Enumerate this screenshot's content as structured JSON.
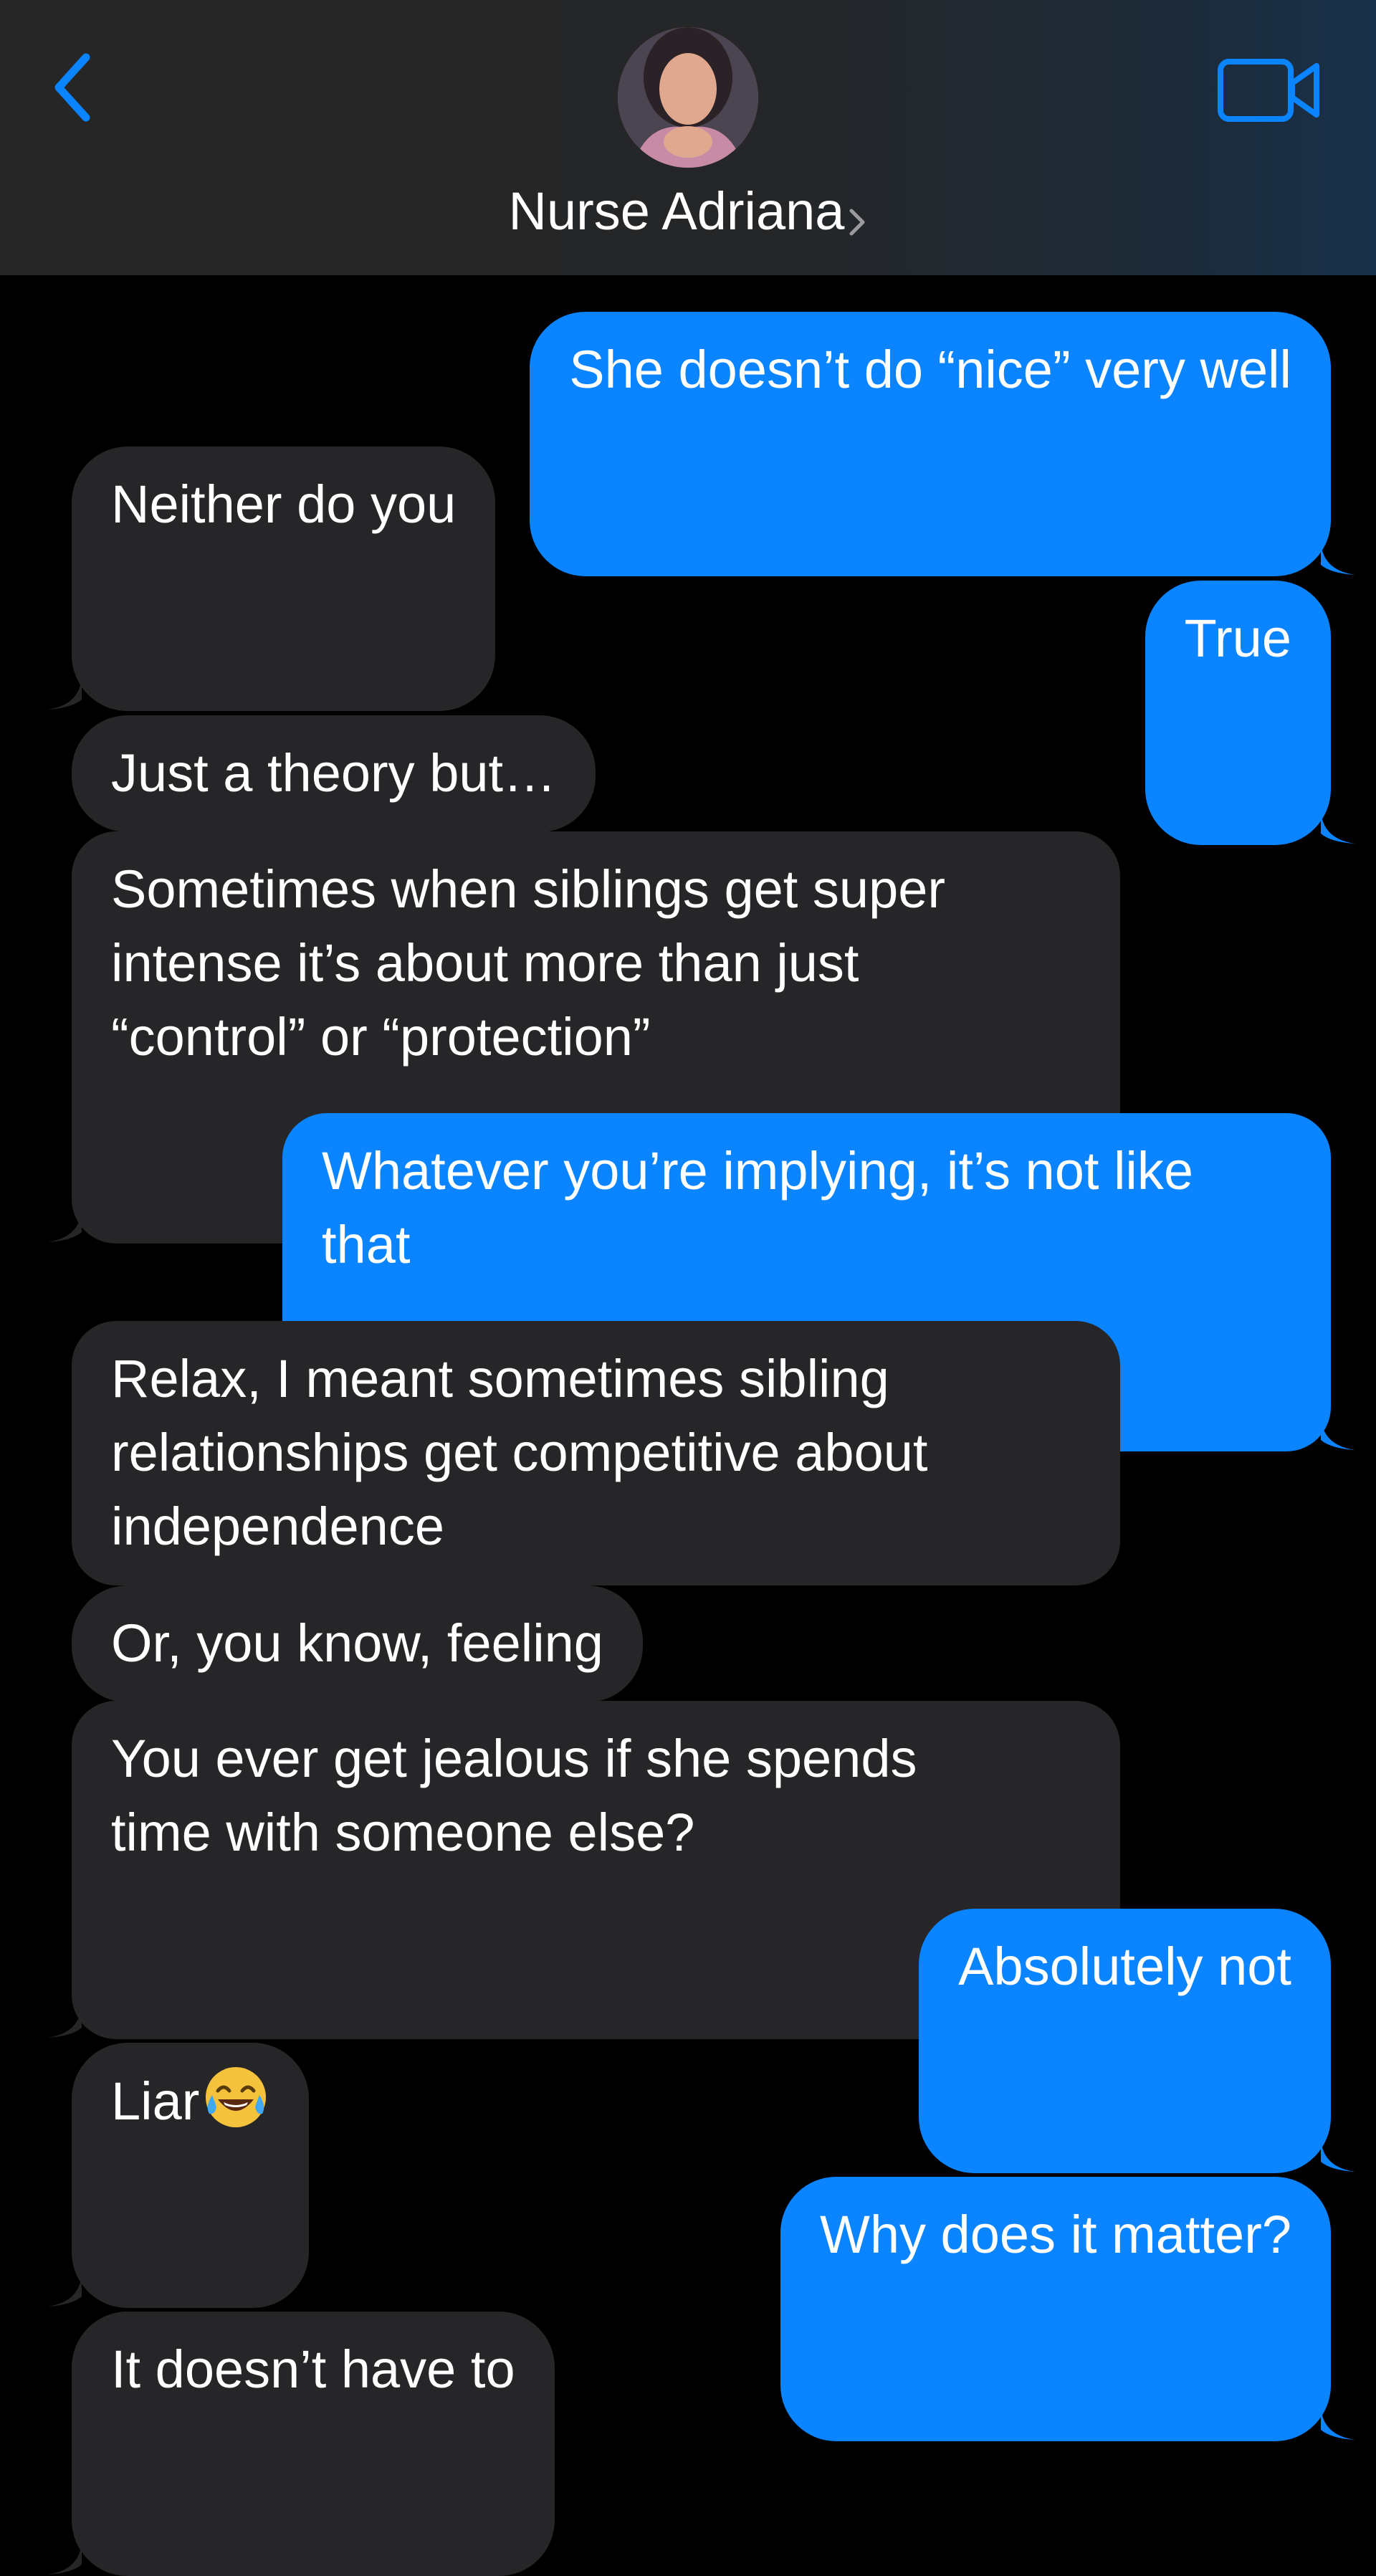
{
  "header": {
    "contact_name": "Nurse Adriana",
    "back_icon": "chevron-left-icon",
    "video_icon": "video-camera-icon",
    "accent_color": "#0a84ff"
  },
  "messages": [
    {
      "from": "me",
      "text": "She doesn’t do “nice” very well"
    },
    {
      "from": "them",
      "text": "Neither do you"
    },
    {
      "from": "me",
      "text": "True"
    },
    {
      "from": "them",
      "text": "Just a theory but…"
    },
    {
      "from": "them",
      "text": "Sometimes when siblings get super\nintense it’s about more than just\n“control” or “protection”"
    },
    {
      "from": "me",
      "text": "Whatever you’re implying, it’s not like\nthat"
    },
    {
      "from": "them",
      "text": "Relax, I meant sometimes sibling\nrelationships get competitive about\nindependence"
    },
    {
      "from": "them",
      "text": "Or, you know, feeling"
    },
    {
      "from": "them",
      "text": "You ever get jealous if she spends\ntime with someone else?"
    },
    {
      "from": "me",
      "text": "Absolutely not"
    },
    {
      "from": "them",
      "text": "Liar",
      "emoji": "face-with-tears-of-joy-emoji"
    },
    {
      "from": "me",
      "text": "Why does it matter?"
    },
    {
      "from": "them",
      "text": "It doesn’t have to"
    }
  ]
}
